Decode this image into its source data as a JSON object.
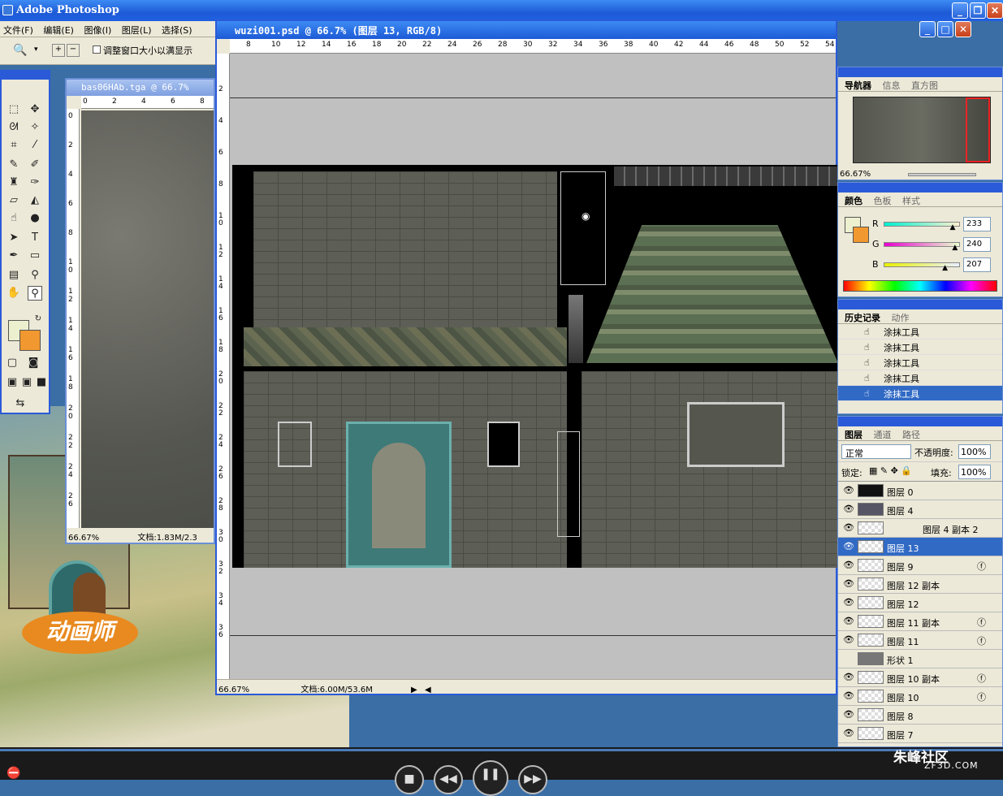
{
  "app": {
    "title": "Adobe Photoshop"
  },
  "menu": [
    "文件(F)",
    "编辑(E)",
    "图像(I)",
    "图层(L)",
    "选择(S)"
  ],
  "options": {
    "resize_label": "调整窗口大小以满显示"
  },
  "doc1": {
    "title": "bas06HAb.tga @ 66.7%",
    "zoom": "66.67%",
    "doc_size": "文档:1.83M/2.3",
    "hticks": [
      "0",
      "2",
      "4",
      "6",
      "8"
    ],
    "vticks": [
      "0",
      "2",
      "4",
      "6",
      "8",
      "1 0",
      "1 2",
      "1 4",
      "1 6",
      "1 8",
      "2 0",
      "2 2",
      "2 4",
      "2 6"
    ]
  },
  "doc2": {
    "title": "wuzi001.psd @ 66.7% (图层 13, RGB/8)",
    "zoom": "66.67%",
    "doc_size": "文档:6.00M/53.6M",
    "hticks": [
      "8",
      "10",
      "12",
      "14",
      "16",
      "18",
      "20",
      "22",
      "24",
      "26",
      "28",
      "30",
      "32",
      "34",
      "36",
      "38",
      "40",
      "42",
      "44",
      "46",
      "48",
      "50",
      "52",
      "54"
    ],
    "vticks": [
      "2",
      "4",
      "6",
      "8",
      "1 0",
      "1 2",
      "1 4",
      "1 6",
      "1 8",
      "2 0",
      "2 2",
      "2 4",
      "2 6",
      "2 8",
      "3 0",
      "3 2",
      "3 4",
      "3 6"
    ]
  },
  "navigator": {
    "tabs": [
      "导航器",
      "信息",
      "直方图"
    ],
    "zoom": "66.67%"
  },
  "color": {
    "tabs": [
      "颜色",
      "色板",
      "样式"
    ],
    "channels": [
      {
        "label": "R",
        "value": "233",
        "fraction": 0.91
      },
      {
        "label": "G",
        "value": "240",
        "fraction": 0.94
      },
      {
        "label": "B",
        "value": "207",
        "fraction": 0.81
      }
    ]
  },
  "history": {
    "tabs": [
      "历史记录",
      "动作"
    ],
    "items": [
      "涂抹工具",
      "涂抹工具",
      "涂抹工具",
      "涂抹工具",
      "涂抹工具"
    ]
  },
  "layers": {
    "tabs": [
      "图层",
      "通道",
      "路径"
    ],
    "blend_mode": "正常",
    "opacity_label": "不透明度:",
    "opacity": "100%",
    "lock_label": "锁定:",
    "fill_label": "填充:",
    "fill": "100%",
    "items": [
      "图层 0",
      "图层 4",
      "图层 4 副本 2",
      "图层 13",
      "图层 9",
      "图层 12 副本",
      "图层 12",
      "图层 11 副本",
      "图层 11",
      "形状 1",
      "图层 10 副本",
      "图层 10",
      "图层 8",
      "图层 7"
    ]
  },
  "branding": {
    "badge": "动画师",
    "watermark": "朱峰社区",
    "watermark_sub": "ZF3D.COM"
  },
  "colors": {
    "title_blue": "#2a5ad8",
    "selection": "#316ac5",
    "foreground": "#edf0cf",
    "background": "#f29830"
  }
}
